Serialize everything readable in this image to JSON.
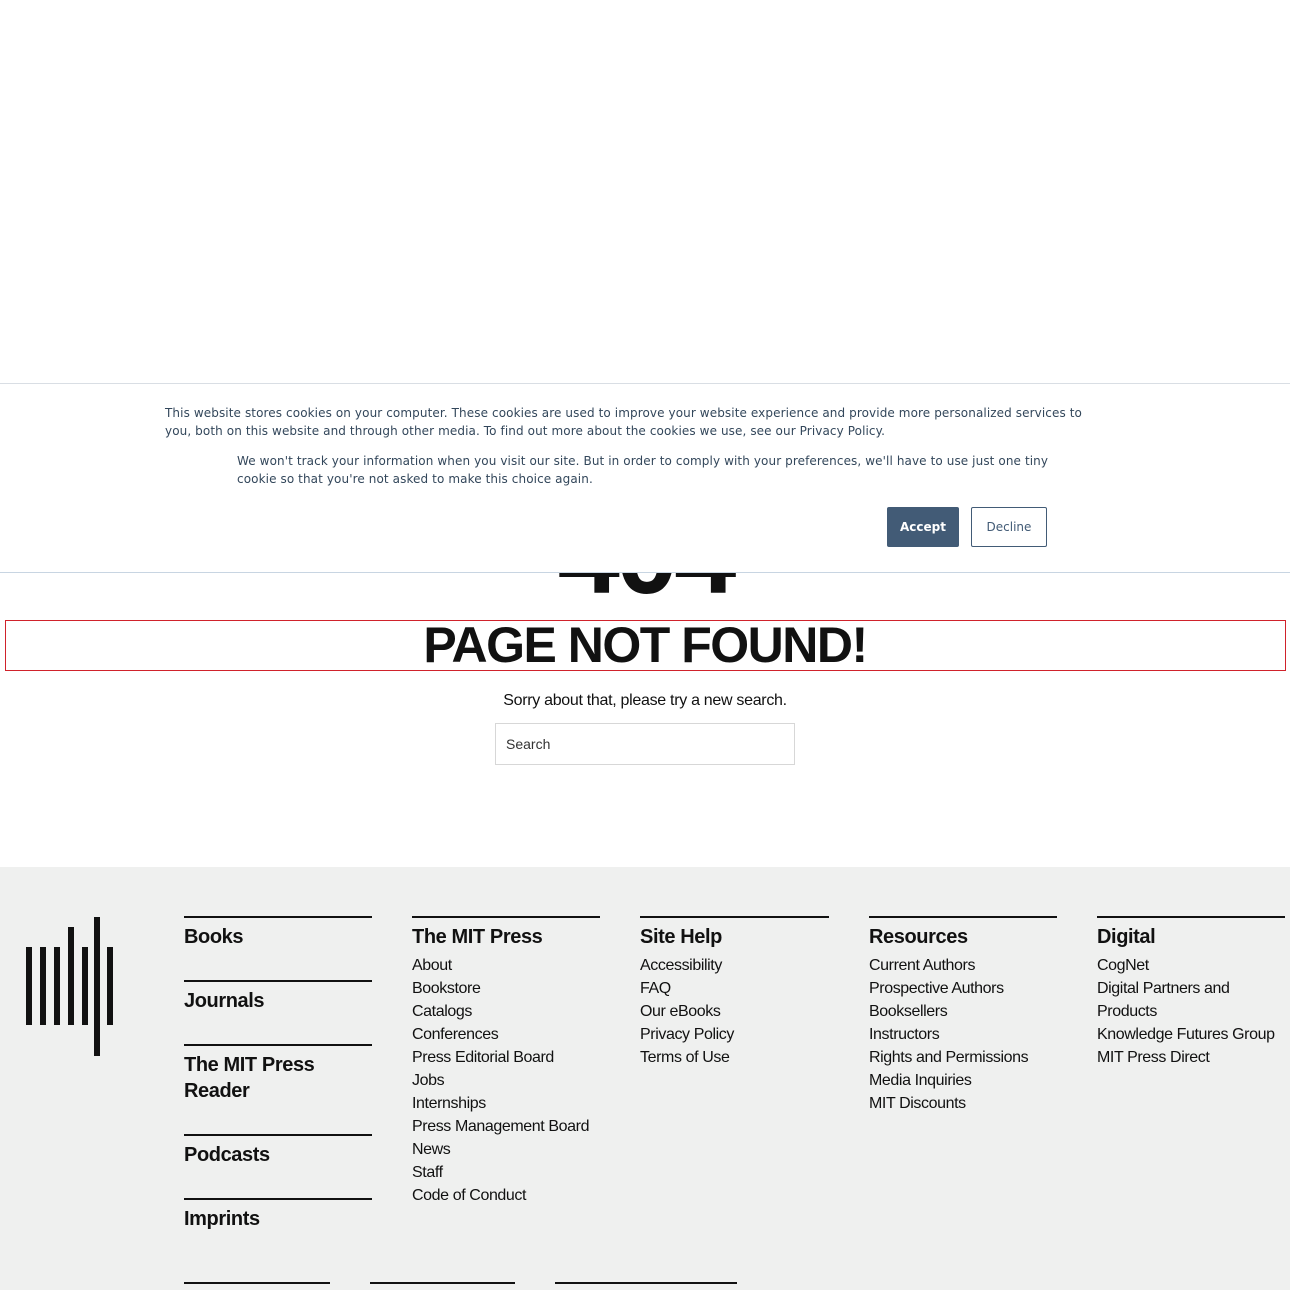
{
  "error": {
    "code": "404",
    "title": "PAGE NOT FOUND!",
    "message": "Sorry about that, please try a new search.",
    "search_placeholder": "Search"
  },
  "cookie_banner": {
    "text_primary": "This website stores cookies on your computer. These cookies are used to improve your website experience and provide more personalized services to you, both on this website and through other media. To find out more about the cookies we use, see our Privacy Policy.",
    "text_secondary": "We won't track your information when you visit our site. But in order to comply with your preferences, we'll have to use just one tiny cookie so that you're not asked to make this choice again.",
    "accept_label": "Accept",
    "decline_label": "Decline",
    "accent_color": "#425b76"
  },
  "footer": {
    "logo_icon": "mit-press-logo-icon",
    "primary_links": [
      "Books",
      "Journals",
      "The MIT Press Reader",
      "Podcasts",
      "Imprints"
    ],
    "columns": [
      {
        "heading": "The MIT Press",
        "links": [
          "About",
          "Bookstore",
          "Catalogs",
          "Conferences",
          "Press Editorial Board",
          "Jobs",
          "Internships",
          "Press Management Board",
          "News",
          "Staff",
          "Code of Conduct"
        ]
      },
      {
        "heading": "Site Help",
        "links": [
          "Accessibility",
          "FAQ",
          "Our eBooks",
          "Privacy Policy",
          "Terms of Use"
        ]
      },
      {
        "heading": "Resources",
        "links": [
          "Current Authors",
          "Prospective Authors",
          "Booksellers",
          "Instructors",
          "Rights and Permissions",
          "Media Inquiries",
          "MIT Discounts"
        ]
      },
      {
        "heading": "Digital",
        "links": [
          "CogNet",
          "Digital Partners and Products",
          "Knowledge Futures Group",
          "MIT Press Direct"
        ]
      }
    ]
  }
}
